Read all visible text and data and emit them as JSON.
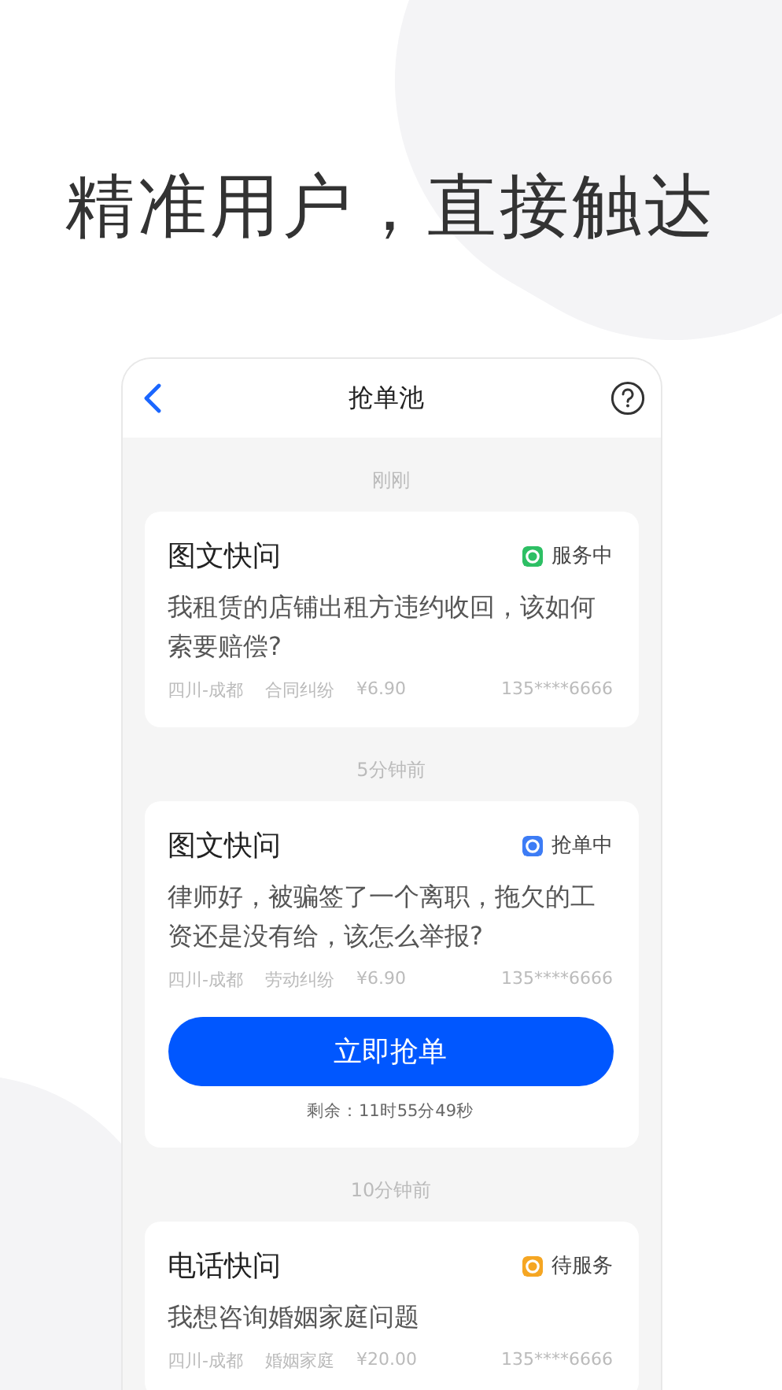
{
  "headline": "精准用户，直接触达",
  "nav": {
    "title": "抢单池"
  },
  "groups": [
    {
      "time": "刚刚",
      "card": {
        "title": "图文快问",
        "status": "服务中",
        "color": "#2dbf64",
        "question": "我租赁的店铺出租方违约收回，该如何索要赔偿?",
        "region": "四川-成都",
        "category": "合同纠纷",
        "price": "¥6.90",
        "phone": "135****6666"
      }
    },
    {
      "time": "5分钟前",
      "card": {
        "title": "图文快问",
        "status": "抢单中",
        "color": "#3d7cf5",
        "question": "律师好，被骗签了一个离职，拖欠的工资还是没有给，该怎么举报?",
        "region": "四川-成都",
        "category": "劳动纠纷",
        "price": "¥6.90",
        "phone": "135****6666",
        "action": "立即抢单",
        "remaining": "剩余：11时55分49秒"
      }
    },
    {
      "time": "10分钟前",
      "card": {
        "title": "电话快问",
        "status": "待服务",
        "color": "#f5a623",
        "question": "我想咨询婚姻家庭问题",
        "region": "四川-成都",
        "category": "婚姻家庭",
        "price": "¥20.00",
        "phone": "135****6666"
      }
    }
  ]
}
